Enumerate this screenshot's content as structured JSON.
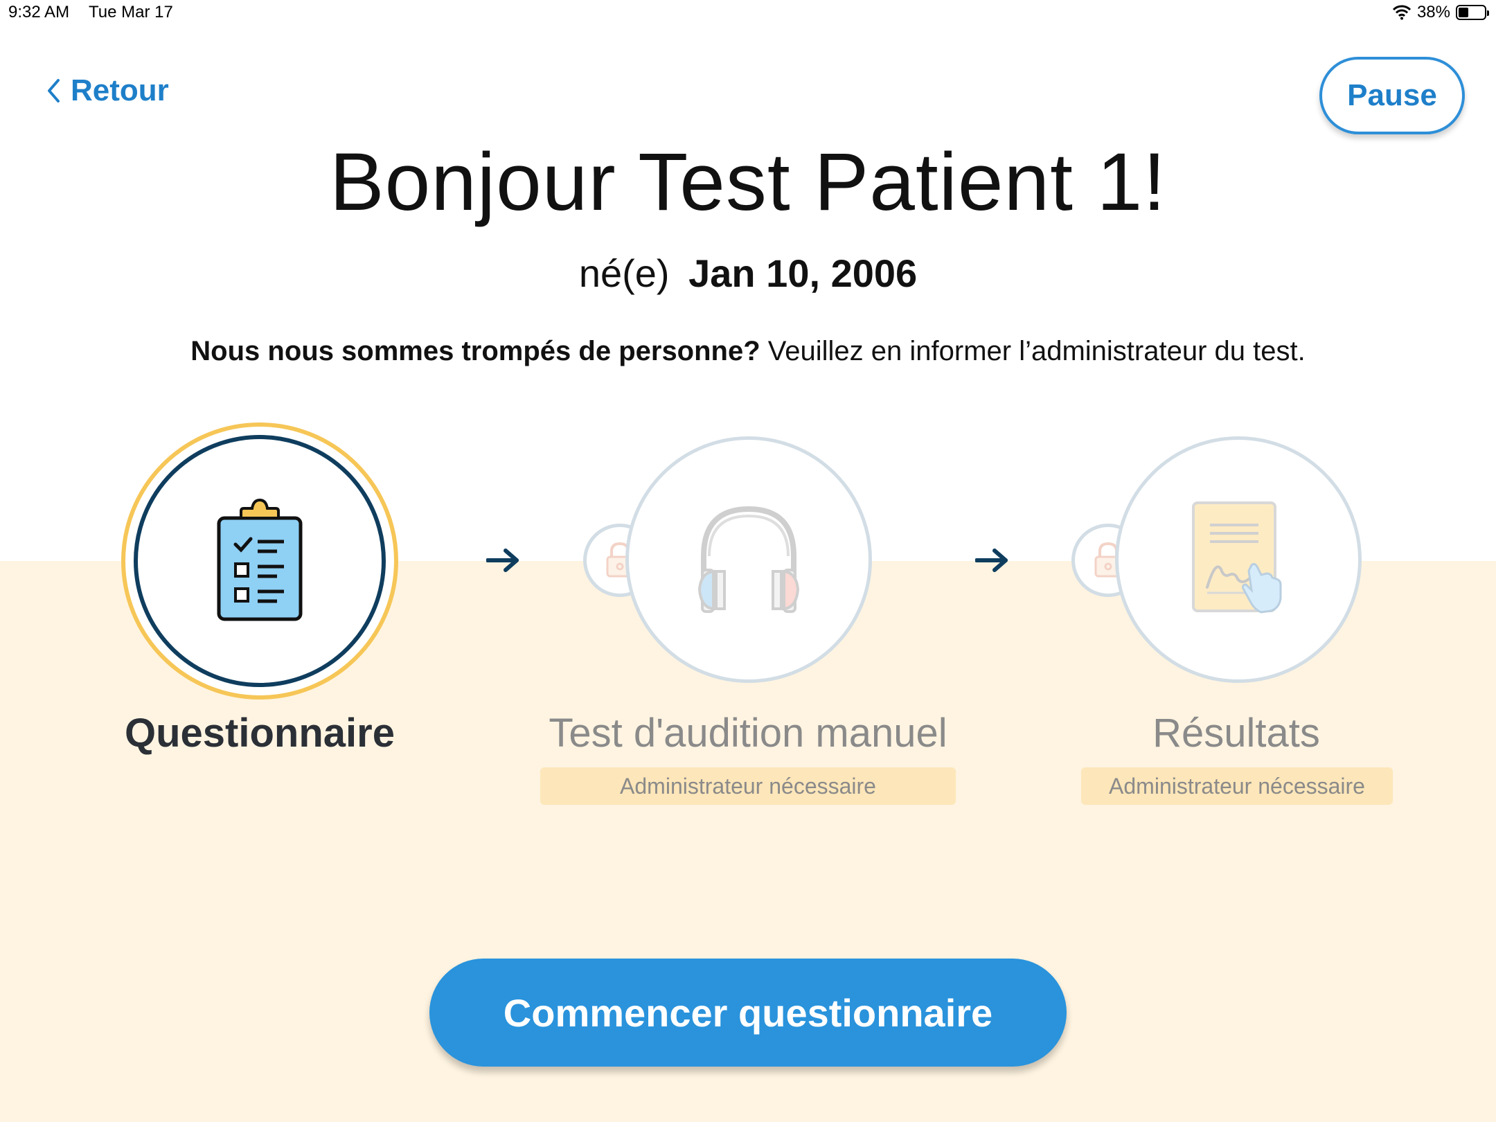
{
  "status_bar": {
    "time": "9:32 AM",
    "date": "Tue Mar 17",
    "battery": "38%",
    "battery_level": 0.38,
    "icons": [
      "wifi-icon",
      "battery-icon"
    ]
  },
  "nav": {
    "back_label": "Retour",
    "pause_label": "Pause"
  },
  "greeting": {
    "title": "Bonjour Test Patient 1!",
    "dob_prefix": "né(e)",
    "dob_value": "Jan 10, 2006",
    "wrong_person_bold": "Nous nous sommes trompés de personne?",
    "wrong_person_text": " Veuillez en informer l’administrateur du test."
  },
  "steps": [
    {
      "label": "Questionnaire",
      "icon": "clipboard-icon",
      "state": "active"
    },
    {
      "label": "Test d'audition manuel",
      "icon": "headphones-icon",
      "state": "locked",
      "badge": "Administrateur nécessaire"
    },
    {
      "label": "Résultats",
      "icon": "signed-document-icon",
      "state": "locked",
      "badge": "Administrateur nécessaire"
    }
  ],
  "start_button": "Commencer questionnaire",
  "colors": {
    "accent": "#2a93dc",
    "link": "#1e7fc9",
    "active_ring": "#f6c657",
    "active_inner_ring": "#0f3d5e",
    "locked_ring": "#d2dde5",
    "band": "#fff4e1",
    "badge_bg": "#fde6b9"
  }
}
